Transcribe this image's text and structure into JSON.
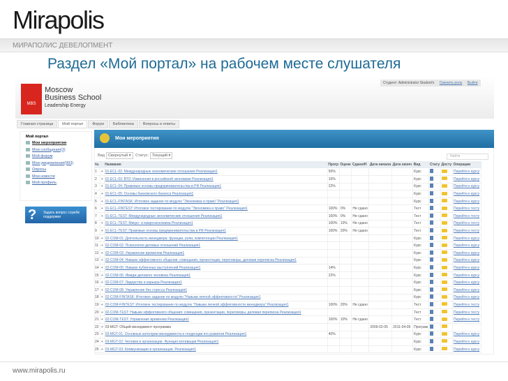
{
  "slide": {
    "logo": "Mirapolis",
    "company": "МИРАПОЛИС ДЕВЕЛОПМЕНТ",
    "title": "Раздел «Мой портал» на рабочем месте слушателя",
    "footer_url": "www.mirapolis.ru"
  },
  "app": {
    "brand": {
      "badge": "MBS",
      "line1": "Moscow",
      "line2": "Business School",
      "line3": "Leadership Energy"
    },
    "user": {
      "label": "Студент: Administrator Student's",
      "change": "Сменить роль",
      "logout": "Выйти"
    },
    "tabs": [
      "Главная страница",
      "Мой портал",
      "Форум",
      "Библиотека",
      "Вопросы и ответы"
    ],
    "sidebar": {
      "heading": "Мой портал",
      "items": [
        "Мои мероприятия",
        "Мои сообщения(3)",
        "Мой форум",
        "Мои уведомления(993)",
        "Опросы",
        "Мои новости",
        "Мой профиль"
      ]
    },
    "help": "Задать вопрос службе поддержки",
    "panel_title": "Мои мероприятия",
    "filters": {
      "view_label": "Вид",
      "view_value": "Свернутый",
      "status_label": "Статус",
      "status_value": "Текущий"
    },
    "search_placeholder": "Найти",
    "columns": [
      "№",
      "",
      "Название",
      "Прогр",
      "Оценк",
      "Сдано/Н",
      "Дата начала",
      "Дата оконч",
      "Вид",
      "Стату",
      "Досту",
      "Операции"
    ],
    "rows": [
      [
        "1",
        "01-ECL-02: Международные экономические отношения Реализация1",
        "50%",
        "",
        "",
        "",
        "",
        "Курс",
        "Перейти к курсу"
      ],
      [
        "2",
        "01-ECL-03: ВТО: Изменения в российской экономике Реализация1",
        "10%",
        "",
        "",
        "",
        "",
        "Курс",
        "Перейти к курсу"
      ],
      [
        "3",
        "01-ECL-04: Правовые основы предпринимательства в РФ Реализация1",
        "22%",
        "",
        "",
        "",
        "",
        "Курс",
        "Перейти к курсу"
      ],
      [
        "4",
        "01-ECL-05: Основы банковского бизнеса Реализация1",
        "",
        "",
        "",
        "",
        "",
        "Курс",
        "Перейти к курсу"
      ],
      [
        "5",
        "01-ECL-FINTASK: Итоговое задание по модулю \"Экономика и право\" Реализация1",
        "",
        "",
        "",
        "",
        "",
        "Курс",
        "Перейти к курсу"
      ],
      [
        "6",
        "01-ECL-FINTEST: Итоговое тестирование по модулю \"Экономика и право\" Реализация1",
        "100%",
        "0%",
        "Не сдано",
        "",
        "",
        "Тест",
        "Перейти к тесту"
      ],
      [
        "7",
        "01-ECL-TEST: Международные экономические отношения Реализация1",
        "100%",
        "0%",
        "Не сдано",
        "",
        "",
        "Тест",
        "Перейти к тесту"
      ],
      [
        "8",
        "01-ECL-TEST: Микро- и макроэкономика Реализация1",
        "100%",
        "10%",
        "Не сдано",
        "",
        "",
        "Тест",
        "Перейти к тесту"
      ],
      [
        "9",
        "01-ECL-TEST: Правовые основы предпринимательства в РФ Реализация1",
        "100%",
        "20%",
        "Не сдано",
        "",
        "",
        "Тест",
        "Перейти к тесту"
      ],
      [
        "10",
        "02-COM-01: Деятельность менеджера: функции, роли, компетенции Реализация1",
        "",
        "",
        "",
        "",
        "",
        "Курс",
        "Перейти к курсу"
      ],
      [
        "11",
        "02-COM-02: Психология деловых отношений Реализация1",
        "",
        "",
        "",
        "",
        "",
        "Курс",
        "Перейти к курсу"
      ],
      [
        "12",
        "02-COM-03: Управление временем Реализация1",
        "",
        "",
        "",
        "",
        "",
        "Курс",
        "Перейти к курсу"
      ],
      [
        "13",
        "02-COM-04: Навыки эффективного общения: совещания, презентации, переговоры, деловая переписка Реализация1",
        "",
        "",
        "",
        "",
        "",
        "Курс",
        "Перейти к курсу"
      ],
      [
        "14",
        "02-COM-05: Навыки публичных выступлений Реализация1",
        "14%",
        "",
        "",
        "",
        "",
        "Курс",
        "Перейти к курсу"
      ],
      [
        "15",
        "02-COM-06: Имидж делового человека Реализация1",
        "22%",
        "",
        "",
        "",
        "",
        "Курс",
        "Перейти к курсу"
      ],
      [
        "16",
        "02-COM-07: Лидерство и карьера Реализация1",
        "",
        "",
        "",
        "",
        "",
        "Курс",
        "Перейти к курсу"
      ],
      [
        "17",
        "02-COM-08: Управление без стресса Реализация1",
        "",
        "",
        "",
        "",
        "",
        "Курс",
        "Перейти к курсу"
      ],
      [
        "18",
        "02-COM-FINTASK: Итоговое задание по модулю \"Навыки личной эффективности\" Реализация1",
        "",
        "",
        "",
        "",
        "",
        "Курс",
        "Перейти к курсу"
      ],
      [
        "19",
        "02-COM-FINTEST: Итоговое тестирование по модулю \"Навыки личной эффективности менеджера\" Реализация1",
        "100%",
        "20%",
        "Не сдано",
        "",
        "",
        "Тест",
        "Перейти к тесту"
      ],
      [
        "20",
        "02-COM-TEST: Навыки эффективного общения: совещания, презентации, переговоры, деловая переписка Реализация1",
        "",
        "",
        "",
        "",
        "",
        "Тест",
        "Перейти к тесту"
      ],
      [
        "21",
        "02-COM-TEST: Управление временем Реализация1",
        "100%",
        "10%",
        "Не сдано",
        "",
        "",
        "Тест",
        "Перейти к тесту"
      ],
      [
        "22",
        "03-MGT: Общий менеджмент программа",
        "",
        "",
        "",
        "2009-02-05",
        "2011-04-06",
        "Програм",
        ""
      ],
      [
        "23",
        "03-MGT-01: Основные категории менеджмента и тенденции его развития Реализация1",
        "40%",
        "",
        "",
        "",
        "",
        "Курс",
        "Перейти к курсу"
      ],
      [
        "24",
        "03-MGT-02: Человек в организации. Функция мотивации Реализация1",
        "",
        "",
        "",
        "",
        "",
        "Курс",
        "Перейти к курсу"
      ],
      [
        "25",
        "03-MGT-03: Коммуникации в организации. Реализация1",
        "",
        "",
        "",
        "",
        "",
        "Курс",
        "Перейти к курсу"
      ]
    ]
  }
}
